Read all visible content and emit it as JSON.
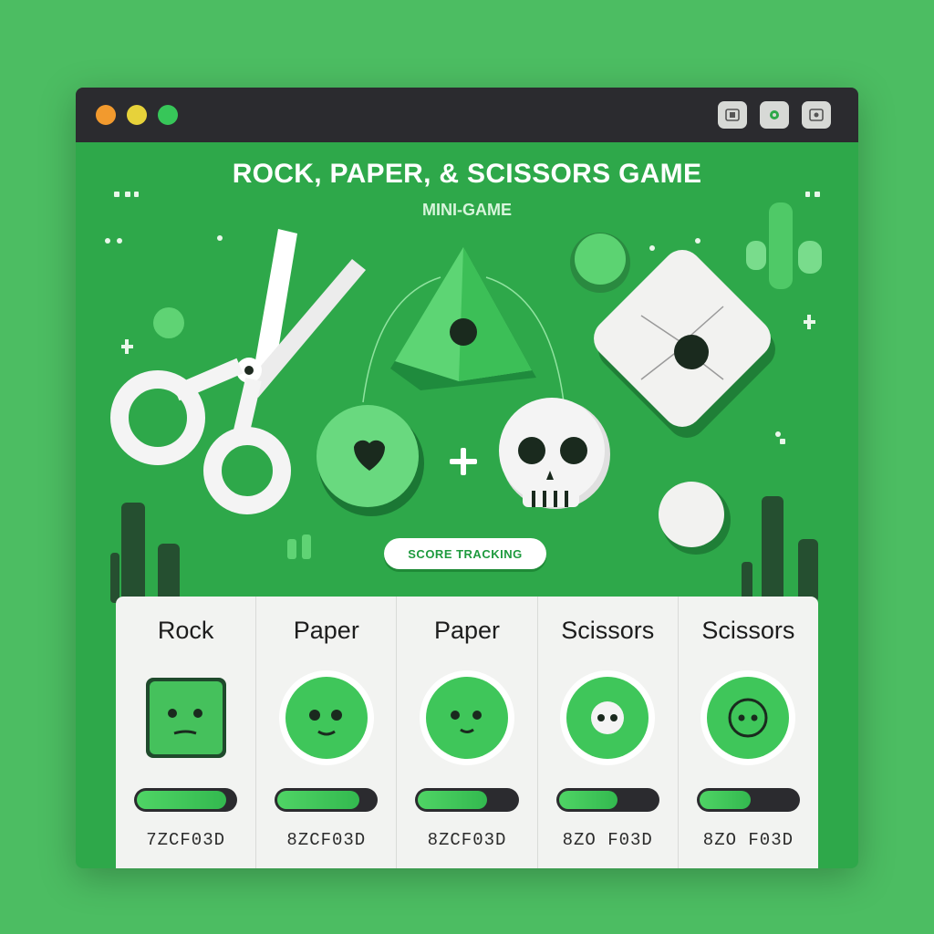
{
  "window": {
    "controls": [
      "close",
      "minimize",
      "maximize"
    ],
    "toolbar_icons": [
      "window-icon",
      "circle-icon",
      "photo-icon"
    ]
  },
  "game": {
    "title": "ROCK, PAPER, & SCISSORS GAME",
    "subtitle": "MINI-GAME",
    "score_button": "SCORE TRACKING"
  },
  "cards": [
    {
      "label": "Rock",
      "code": "7ZCF03D",
      "progress": 0.92,
      "face": "square"
    },
    {
      "label": "Paper",
      "code": "8ZCF03D",
      "progress": 0.85,
      "face": "circle-smile"
    },
    {
      "label": "Paper",
      "code": "8ZCF03D",
      "progress": 0.72,
      "face": "circle-smile"
    },
    {
      "label": "Scissors",
      "code": "8ZO F03D",
      "progress": 0.62,
      "face": "circle-eyes"
    },
    {
      "label": "Scissors",
      "code": "8ZO F03D",
      "progress": 0.55,
      "face": "circle-ring"
    }
  ],
  "colors": {
    "background": "#4cbd62",
    "window": "#2ea84a",
    "titlebar": "#2b2b2f",
    "accent": "#3fc85a"
  }
}
